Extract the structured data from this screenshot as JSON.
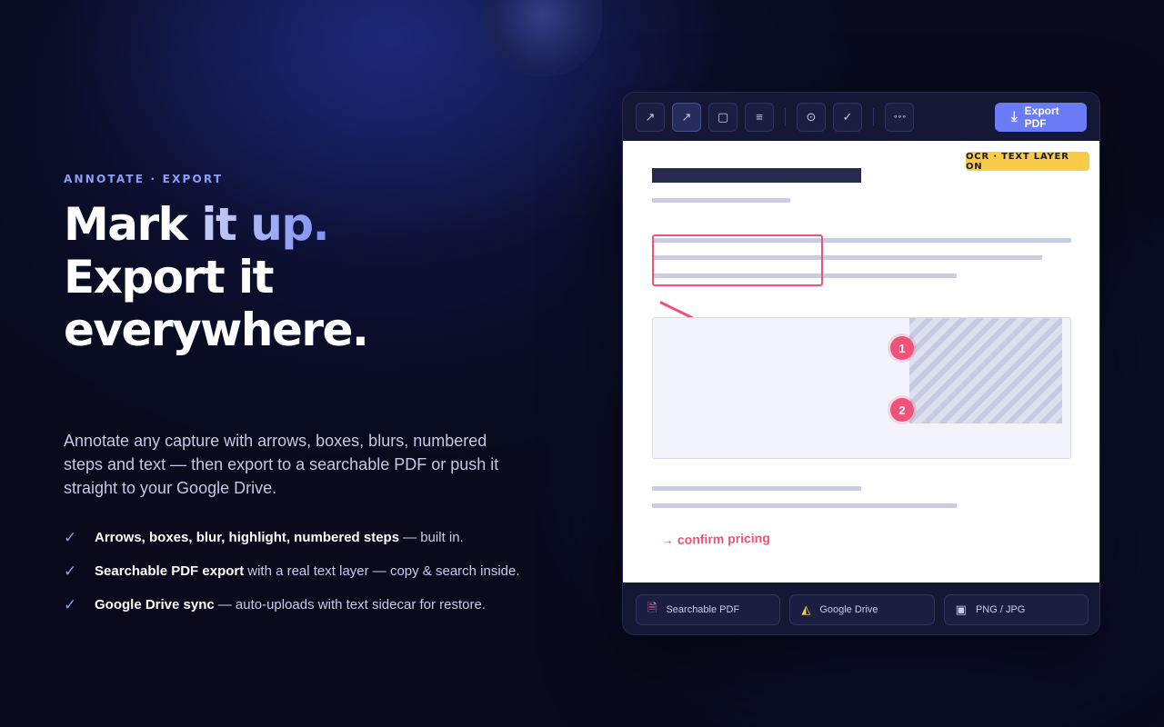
{
  "hero": {
    "eyebrow": "ANNOTATE · EXPORT",
    "headline_line1_plain": "Mark ",
    "headline_line1_accent": "it up.",
    "headline_line2": "Export it everywhere.",
    "lead": "Annotate any capture with arrows, boxes, blurs, numbered steps and text — then export to a searchable PDF or push it straight to your Google Drive.",
    "features": [
      {
        "bold": "Arrows, boxes, blur, highlight, numbered steps",
        "rest": "— built in."
      },
      {
        "bold": "Searchable PDF export",
        "rest": "with a real text layer — copy & search inside."
      },
      {
        "bold": "Google Drive sync",
        "rest": "— auto-uploads with text sidecar for restore."
      }
    ]
  },
  "editor": {
    "tools": {
      "trend": "↗",
      "arrow": "↗",
      "box": "▢",
      "text": "≡",
      "step": "⊙",
      "check": "✓",
      "more": "∘∘∘"
    },
    "export_label": "Export PDF",
    "export_icon": "⤓",
    "ocr_badge": "OCR · TEXT LAYER ON",
    "steps": [
      "1",
      "2"
    ],
    "note": "→ confirm pricing",
    "exports": [
      {
        "icon": "🗎",
        "label": "Searchable PDF"
      },
      {
        "icon": "◭",
        "label": "Google Drive"
      },
      {
        "icon": "▣",
        "label": "PNG / JPG"
      }
    ],
    "colors": {
      "accent": "#6b7bf6",
      "annotation": "#ef5378",
      "badge": "#f9cb48"
    }
  }
}
